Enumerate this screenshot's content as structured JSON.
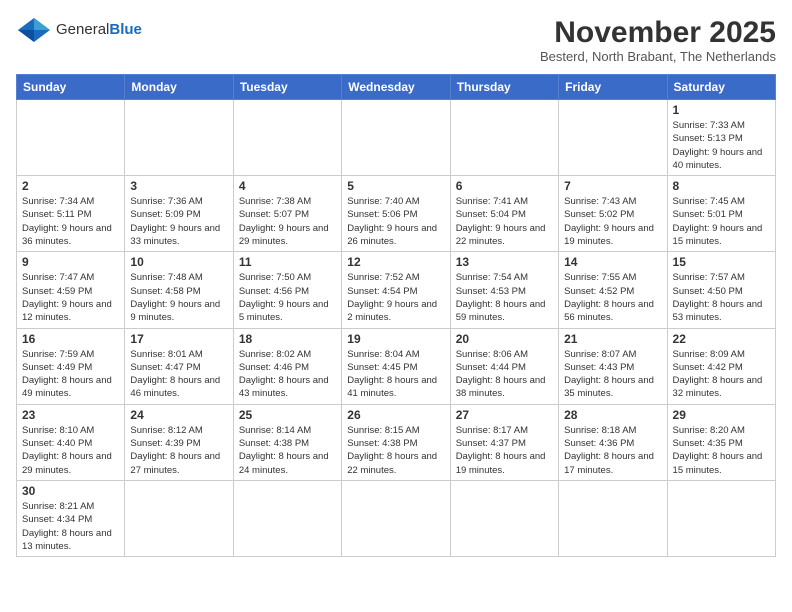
{
  "logo": {
    "text_general": "General",
    "text_blue": "Blue"
  },
  "title": "November 2025",
  "subtitle": "Besterd, North Brabant, The Netherlands",
  "days_of_week": [
    "Sunday",
    "Monday",
    "Tuesday",
    "Wednesday",
    "Thursday",
    "Friday",
    "Saturday"
  ],
  "weeks": [
    [
      {
        "day": "",
        "info": ""
      },
      {
        "day": "",
        "info": ""
      },
      {
        "day": "",
        "info": ""
      },
      {
        "day": "",
        "info": ""
      },
      {
        "day": "",
        "info": ""
      },
      {
        "day": "",
        "info": ""
      },
      {
        "day": "1",
        "info": "Sunrise: 7:33 AM\nSunset: 5:13 PM\nDaylight: 9 hours\nand 40 minutes."
      }
    ],
    [
      {
        "day": "2",
        "info": "Sunrise: 7:34 AM\nSunset: 5:11 PM\nDaylight: 9 hours\nand 36 minutes."
      },
      {
        "day": "3",
        "info": "Sunrise: 7:36 AM\nSunset: 5:09 PM\nDaylight: 9 hours\nand 33 minutes."
      },
      {
        "day": "4",
        "info": "Sunrise: 7:38 AM\nSunset: 5:07 PM\nDaylight: 9 hours\nand 29 minutes."
      },
      {
        "day": "5",
        "info": "Sunrise: 7:40 AM\nSunset: 5:06 PM\nDaylight: 9 hours\nand 26 minutes."
      },
      {
        "day": "6",
        "info": "Sunrise: 7:41 AM\nSunset: 5:04 PM\nDaylight: 9 hours\nand 22 minutes."
      },
      {
        "day": "7",
        "info": "Sunrise: 7:43 AM\nSunset: 5:02 PM\nDaylight: 9 hours\nand 19 minutes."
      },
      {
        "day": "8",
        "info": "Sunrise: 7:45 AM\nSunset: 5:01 PM\nDaylight: 9 hours\nand 15 minutes."
      }
    ],
    [
      {
        "day": "9",
        "info": "Sunrise: 7:47 AM\nSunset: 4:59 PM\nDaylight: 9 hours\nand 12 minutes."
      },
      {
        "day": "10",
        "info": "Sunrise: 7:48 AM\nSunset: 4:58 PM\nDaylight: 9 hours\nand 9 minutes."
      },
      {
        "day": "11",
        "info": "Sunrise: 7:50 AM\nSunset: 4:56 PM\nDaylight: 9 hours\nand 5 minutes."
      },
      {
        "day": "12",
        "info": "Sunrise: 7:52 AM\nSunset: 4:54 PM\nDaylight: 9 hours\nand 2 minutes."
      },
      {
        "day": "13",
        "info": "Sunrise: 7:54 AM\nSunset: 4:53 PM\nDaylight: 8 hours\nand 59 minutes."
      },
      {
        "day": "14",
        "info": "Sunrise: 7:55 AM\nSunset: 4:52 PM\nDaylight: 8 hours\nand 56 minutes."
      },
      {
        "day": "15",
        "info": "Sunrise: 7:57 AM\nSunset: 4:50 PM\nDaylight: 8 hours\nand 53 minutes."
      }
    ],
    [
      {
        "day": "16",
        "info": "Sunrise: 7:59 AM\nSunset: 4:49 PM\nDaylight: 8 hours\nand 49 minutes."
      },
      {
        "day": "17",
        "info": "Sunrise: 8:01 AM\nSunset: 4:47 PM\nDaylight: 8 hours\nand 46 minutes."
      },
      {
        "day": "18",
        "info": "Sunrise: 8:02 AM\nSunset: 4:46 PM\nDaylight: 8 hours\nand 43 minutes."
      },
      {
        "day": "19",
        "info": "Sunrise: 8:04 AM\nSunset: 4:45 PM\nDaylight: 8 hours\nand 41 minutes."
      },
      {
        "day": "20",
        "info": "Sunrise: 8:06 AM\nSunset: 4:44 PM\nDaylight: 8 hours\nand 38 minutes."
      },
      {
        "day": "21",
        "info": "Sunrise: 8:07 AM\nSunset: 4:43 PM\nDaylight: 8 hours\nand 35 minutes."
      },
      {
        "day": "22",
        "info": "Sunrise: 8:09 AM\nSunset: 4:42 PM\nDaylight: 8 hours\nand 32 minutes."
      }
    ],
    [
      {
        "day": "23",
        "info": "Sunrise: 8:10 AM\nSunset: 4:40 PM\nDaylight: 8 hours\nand 29 minutes."
      },
      {
        "day": "24",
        "info": "Sunrise: 8:12 AM\nSunset: 4:39 PM\nDaylight: 8 hours\nand 27 minutes."
      },
      {
        "day": "25",
        "info": "Sunrise: 8:14 AM\nSunset: 4:38 PM\nDaylight: 8 hours\nand 24 minutes."
      },
      {
        "day": "26",
        "info": "Sunrise: 8:15 AM\nSunset: 4:38 PM\nDaylight: 8 hours\nand 22 minutes."
      },
      {
        "day": "27",
        "info": "Sunrise: 8:17 AM\nSunset: 4:37 PM\nDaylight: 8 hours\nand 19 minutes."
      },
      {
        "day": "28",
        "info": "Sunrise: 8:18 AM\nSunset: 4:36 PM\nDaylight: 8 hours\nand 17 minutes."
      },
      {
        "day": "29",
        "info": "Sunrise: 8:20 AM\nSunset: 4:35 PM\nDaylight: 8 hours\nand 15 minutes."
      }
    ],
    [
      {
        "day": "30",
        "info": "Sunrise: 8:21 AM\nSunset: 4:34 PM\nDaylight: 8 hours\nand 13 minutes."
      },
      {
        "day": "",
        "info": ""
      },
      {
        "day": "",
        "info": ""
      },
      {
        "day": "",
        "info": ""
      },
      {
        "day": "",
        "info": ""
      },
      {
        "day": "",
        "info": ""
      },
      {
        "day": "",
        "info": ""
      }
    ]
  ]
}
